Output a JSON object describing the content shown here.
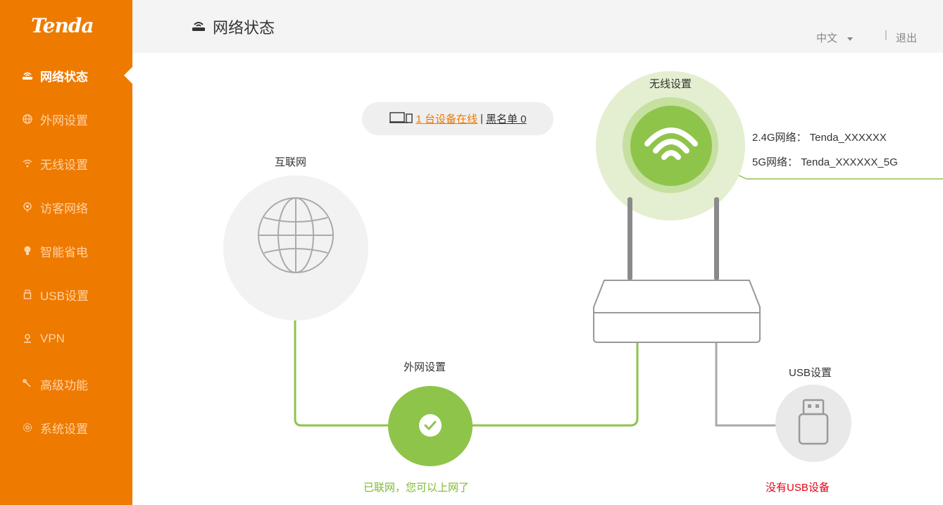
{
  "brand": {
    "logo_text": "Tenda",
    "accent_color": "#ee7a00"
  },
  "sidebar": {
    "items": [
      {
        "label": "网络状态",
        "icon": "router-icon",
        "active": true
      },
      {
        "label": "外网设置",
        "icon": "globe-icon"
      },
      {
        "label": "无线设置",
        "icon": "wifi-icon"
      },
      {
        "label": "访客网络",
        "icon": "guest-icon"
      },
      {
        "label": "智能省电",
        "icon": "bulb-icon"
      },
      {
        "label": "USB设置",
        "icon": "usb-icon"
      },
      {
        "label": "VPN",
        "icon": "vpn-icon"
      },
      {
        "label": "高级功能",
        "icon": "wrench-icon"
      },
      {
        "label": "系统设置",
        "icon": "gear-icon"
      }
    ]
  },
  "header": {
    "title": "网络状态",
    "language": "中文",
    "separator": "|",
    "logout": "退出"
  },
  "devices": {
    "online": "1 台设备在线",
    "separator": "|",
    "blacklist": "黑名单 0"
  },
  "internet": {
    "label": "互联网"
  },
  "wan": {
    "label": "外网设置",
    "status": "已联网，您可以上网了",
    "status_color": "#7cba2f"
  },
  "wireless": {
    "label": "无线设置",
    "network_24g": "2.4G网络： Tenda_XXXXXX",
    "network_5g": "5G网络： Tenda_XXXXXX_5G",
    "color": "#8fc44a"
  },
  "usb": {
    "label": "USB设置",
    "status": "没有USB设备",
    "status_color": "#e60012"
  }
}
